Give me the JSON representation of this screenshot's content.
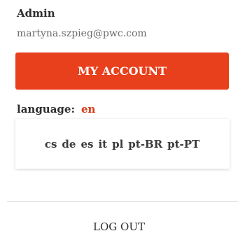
{
  "user": {
    "name": "Admin",
    "email": "martyna.szpieg@pwc.com"
  },
  "account_button": {
    "label": "MY ACCOUNT"
  },
  "language": {
    "label": "language:",
    "current": "en",
    "options": [
      "cs",
      "de",
      "es",
      "it",
      "pl",
      "pt-BR",
      "pt-PT"
    ]
  },
  "logout": {
    "label": "LOG OUT"
  },
  "colors": {
    "accent": "#e8401c",
    "current_language": "#d93a17",
    "text": "#2d2d2d",
    "muted_text": "#6b6b6b",
    "divider": "#dcdcdc"
  }
}
